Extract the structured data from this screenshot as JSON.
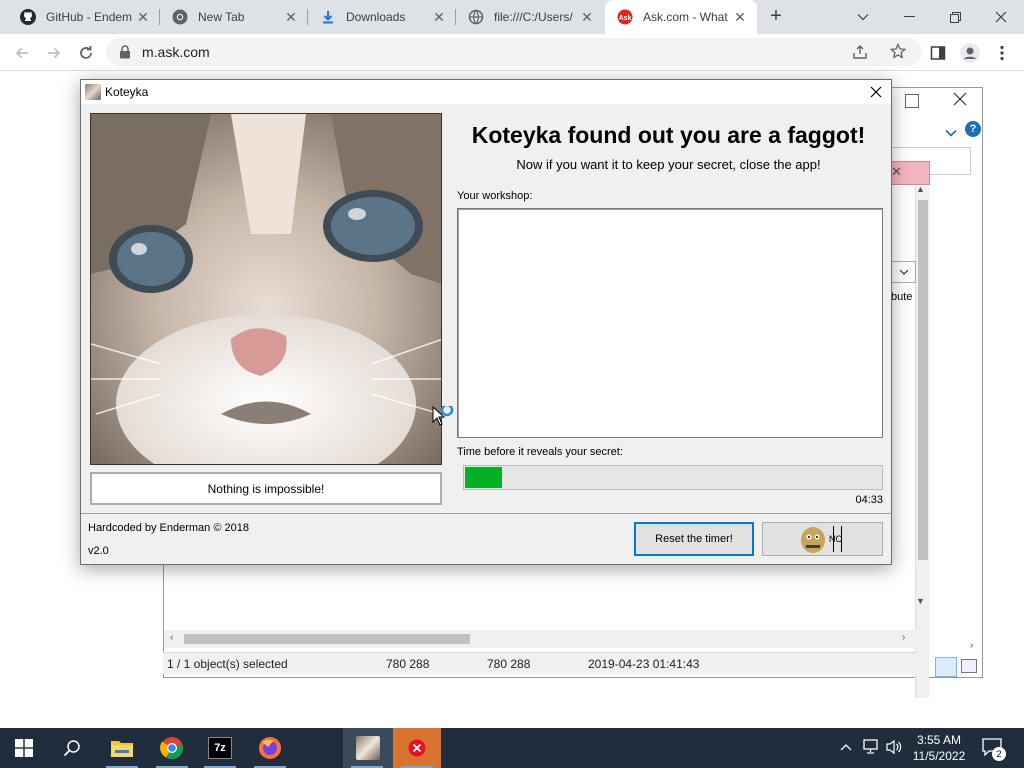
{
  "browser": {
    "tabs": [
      {
        "title": "GitHub - Endem",
        "favicon": "github-icon"
      },
      {
        "title": "New Tab",
        "favicon": "chrome-icon"
      },
      {
        "title": "Downloads",
        "favicon": "download-icon"
      },
      {
        "title": "file:///C:/Users/",
        "favicon": "globe-icon"
      },
      {
        "title": "Ask.com - What",
        "favicon": "ask-icon",
        "active": true
      }
    ],
    "url": "m.ask.com"
  },
  "background_window": {
    "status_selected": "1 / 1 object(s) selected",
    "status_size": "780 288",
    "status_packed": "780 288",
    "status_modified": "2019-04-23 01:41:43",
    "partial_column": "bute"
  },
  "dialog": {
    "title": "Koteyka",
    "headline": "Koteyka found out you are a faggot!",
    "subline": "Now if you want it to keep your secret, close the app!",
    "workshop_label": "Your workshop:",
    "workshop_text": "",
    "timer_label": "Time before it reveals your secret:",
    "timer_progress": 0.09,
    "timer_value": "04:33",
    "nothing_button": "Nothing is impossible!",
    "credit": "Hardcoded by Enderman © 2018",
    "version": "v2.0",
    "reset_button": "Reset the timer!",
    "baldi_button_text": "NO",
    "accent_color": "#06b025"
  },
  "taskbar": {
    "apps": [
      "start-icon",
      "search-icon",
      "file-explorer-icon",
      "chrome-icon",
      "7zip-icon",
      "firefox-icon",
      "koteyka-icon",
      "error-app-icon"
    ],
    "time": "3:55 AM",
    "date": "11/5/2022",
    "notification_count": "2"
  }
}
